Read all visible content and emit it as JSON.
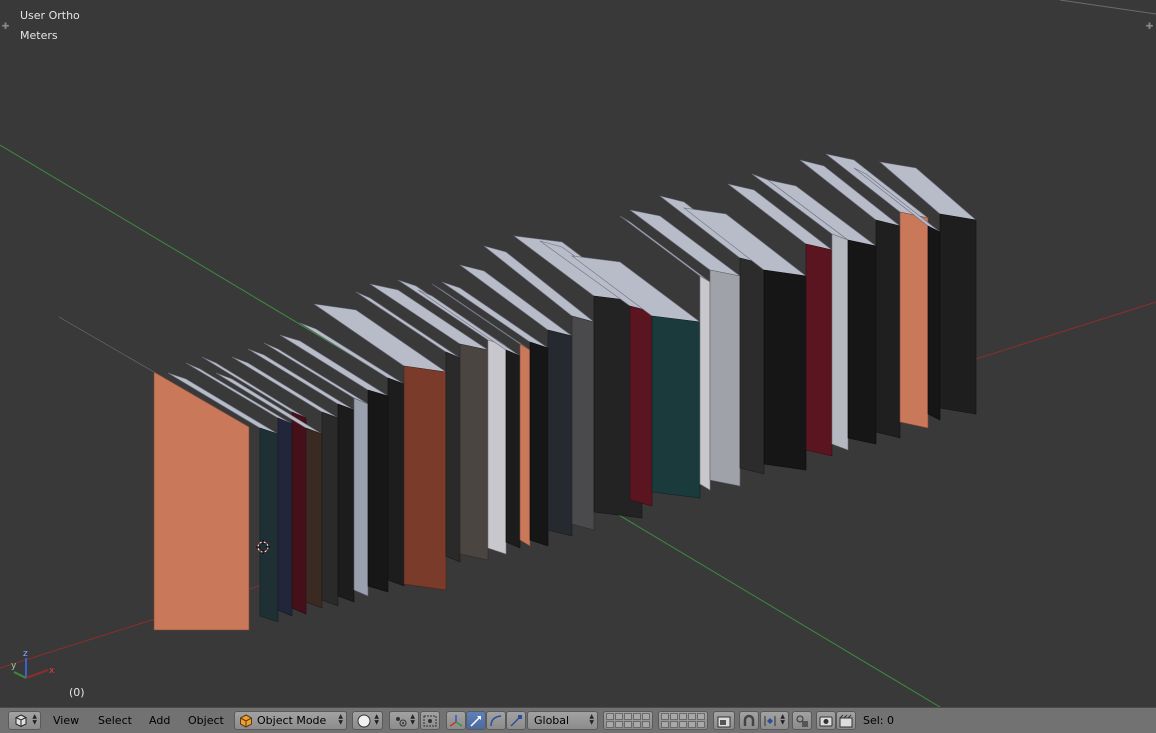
{
  "viewport": {
    "view_name": "User Ortho",
    "units": "Meters",
    "frame": "(0)",
    "background": "#393939",
    "axis_colors": {
      "x": "#8b2e2e",
      "y": "#3f8a3f",
      "z": "#3a5fd0"
    },
    "gizmo_labels": {
      "x": "x",
      "y": "y",
      "z": "z"
    }
  },
  "header": {
    "editor_type_icon": "view3d-icon",
    "menus": {
      "view": "View",
      "select": "Select",
      "add": "Add",
      "object": "Object"
    },
    "mode": {
      "label": "Object Mode",
      "icon": "cube-orange-icon"
    },
    "shading_icon": "solid-sphere-icon",
    "pivot_icon": "pivot-point-icon",
    "manipulator_icons": [
      "manipulator-toggle-icon",
      "translate-icon",
      "rotate-icon",
      "scale-icon"
    ],
    "orientation": "Global",
    "layers_icon": "layers-grid-icon",
    "lock_icon": "lock-camera-icon",
    "snap_icon": "magnet-icon",
    "snap_target_icon": "snap-element-icon",
    "render_icons": [
      "opengl-render-icon",
      "opengl-anim-icon"
    ],
    "status": "Sel: 0"
  }
}
